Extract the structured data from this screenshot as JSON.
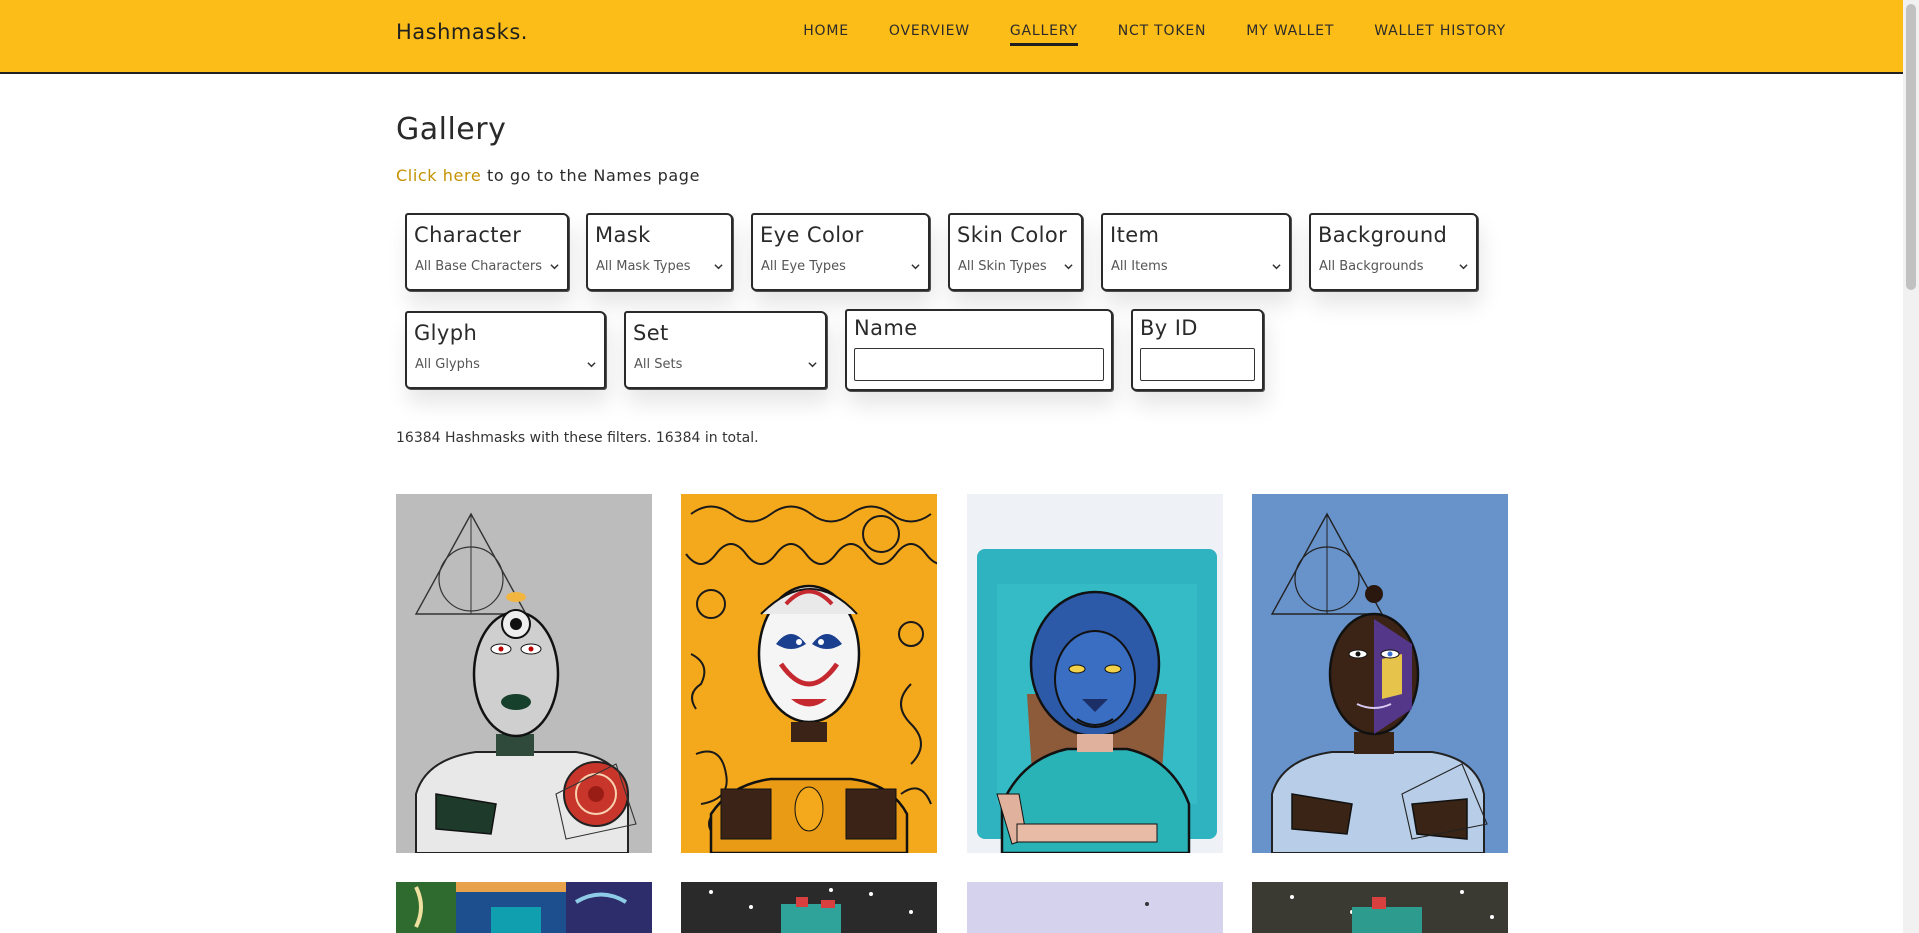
{
  "header": {
    "brand": "Hashmasks.",
    "nav": [
      "HOME",
      "OVERVIEW",
      "GALLERY",
      "NCT TOKEN",
      "MY WALLET",
      "WALLET HISTORY"
    ],
    "active": "GALLERY"
  },
  "page": {
    "title": "Gallery",
    "names_link": "Click here",
    "names_suffix": " to go to the Names page"
  },
  "filters": {
    "character": {
      "label": "Character",
      "value": "All Base Characters"
    },
    "mask": {
      "label": "Mask",
      "value": "All Mask Types"
    },
    "eye_color": {
      "label": "Eye Color",
      "value": "All Eye Types"
    },
    "skin_color": {
      "label": "Skin Color",
      "value": "All Skin Types"
    },
    "item": {
      "label": "Item",
      "value": "All Items"
    },
    "background": {
      "label": "Background",
      "value": "All Backgrounds"
    },
    "glyph": {
      "label": "Glyph",
      "value": "All Glyphs"
    },
    "set": {
      "label": "Set",
      "value": "All Sets"
    },
    "name": {
      "label": "Name",
      "value": ""
    },
    "by_id": {
      "label": "By ID",
      "value": ""
    }
  },
  "results": {
    "summary": "16384 Hashmasks with these filters. 16384 in total."
  },
  "colors": {
    "accent": "#fdbd18",
    "link": "#c49200"
  }
}
